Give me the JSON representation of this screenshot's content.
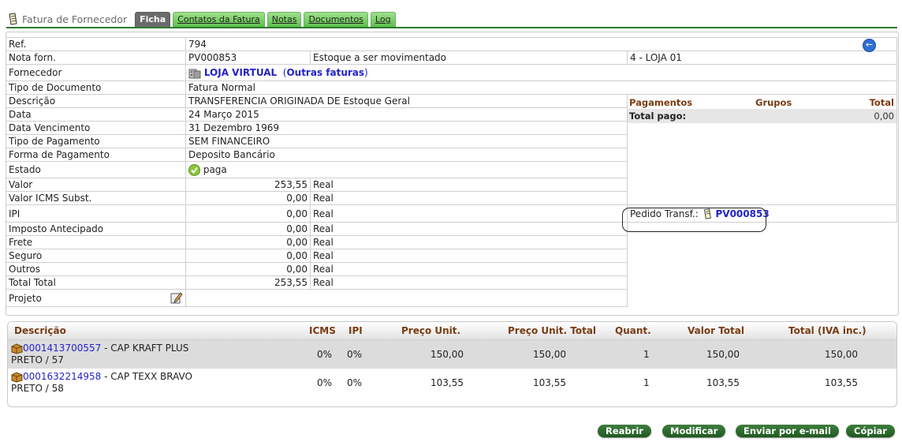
{
  "header": {
    "page_title": "Fatura de Fornecedor",
    "tabs": [
      {
        "label": "Ficha",
        "active": true
      },
      {
        "label": "Contatos da Fatura",
        "active": false
      },
      {
        "label": "Notas",
        "active": false
      },
      {
        "label": "Documentos",
        "active": false
      },
      {
        "label": "Log",
        "active": false
      }
    ],
    "back_icon": "arrow-left-circle-icon"
  },
  "info": {
    "ref": {
      "label": "Ref.",
      "value": "794"
    },
    "nota": {
      "label": "Nota forn.",
      "value": "PV000853",
      "warehouse_label": "Estoque a ser movimentado",
      "warehouse_value": "4 - LOJA 01"
    },
    "fornecedor": {
      "label": "Fornecedor",
      "name": "LOJA VIRTUAL",
      "other_open": "(",
      "other_link": "Outras faturas",
      "other_close": ")"
    },
    "tipo_doc": {
      "label": "Tipo de Documento",
      "value": "Fatura Normal"
    },
    "descricao": {
      "label": "Descrição",
      "value": "TRANSFERENCIA ORIGINADA DE Estoque Geral"
    },
    "data": {
      "label": "Data",
      "value": "24 Março 2015"
    },
    "vencimento": {
      "label": "Data Vencimento",
      "value": "31 Dezembro 1969"
    },
    "tipo_pag": {
      "label": "Tipo de Pagamento",
      "value": "SEM FINANCEIRO"
    },
    "forma_pag": {
      "label": "Forma de Pagamento",
      "value": "Deposito Bancário"
    },
    "estado": {
      "label": "Estado",
      "value": "paga"
    },
    "valor": {
      "label": "Valor",
      "value": "253,55",
      "unit": "Real"
    },
    "icms_subst": {
      "label": "Valor ICMS Subst.",
      "value": "0,00",
      "unit": "Real"
    },
    "ipi": {
      "label": "IPI",
      "value": "0,00",
      "unit": "Real"
    },
    "imposto_ant": {
      "label": "Imposto Antecipado",
      "value": "0,00",
      "unit": "Real"
    },
    "frete": {
      "label": "Frete",
      "value": "0,00",
      "unit": "Real"
    },
    "seguro": {
      "label": "Seguro",
      "value": "0,00",
      "unit": "Real"
    },
    "outros": {
      "label": "Outros",
      "value": "0,00",
      "unit": "Real"
    },
    "total": {
      "label": "Total Total",
      "value": "253,55",
      "unit": "Real"
    },
    "projeto": {
      "label": "Projeto"
    }
  },
  "payments": {
    "col_pagamentos": "Pagamentos",
    "col_grupos": "Grupos",
    "col_total": "Total",
    "total_pago_label": "Total pago:",
    "total_pago_value": "0,00",
    "pedido_label": "Pedido Transf.:",
    "pedido_link": "PV000853"
  },
  "lines": {
    "headers": [
      "Descrição",
      "ICMS",
      "IPI",
      "Preço Unit.",
      "Preço Unit. Total",
      "Quant.",
      "Valor Total",
      "Total (IVA inc.)"
    ],
    "rows": [
      {
        "code": "0001413700557",
        "desc1": " - CAP KRAFT PLUS",
        "desc2": "PRETO / 57",
        "icms": "0%",
        "ipi": "0%",
        "preco": "150,00",
        "preco_total": "150,00",
        "quant": "1",
        "valor_total": "150,00",
        "total_iva": "150,00"
      },
      {
        "code": "0001632214958",
        "desc1": " - CAP TEXX BRAVO",
        "desc2": "PRETO / 58",
        "icms": "0%",
        "ipi": "0%",
        "preco": "103,55",
        "preco_total": "103,55",
        "quant": "1",
        "valor_total": "103,55",
        "total_iva": "103,55"
      }
    ]
  },
  "buttons": {
    "reabrir": "Reabrir",
    "modificar": "Modificar",
    "enviar": "Enviar por e-mail",
    "copiar": "Cópiar"
  },
  "colors": {
    "tab_green": "#5cbf4c",
    "button_green": "#2e6b2e",
    "header_brown": "#7a3b12",
    "link_blue": "#2222cc"
  }
}
